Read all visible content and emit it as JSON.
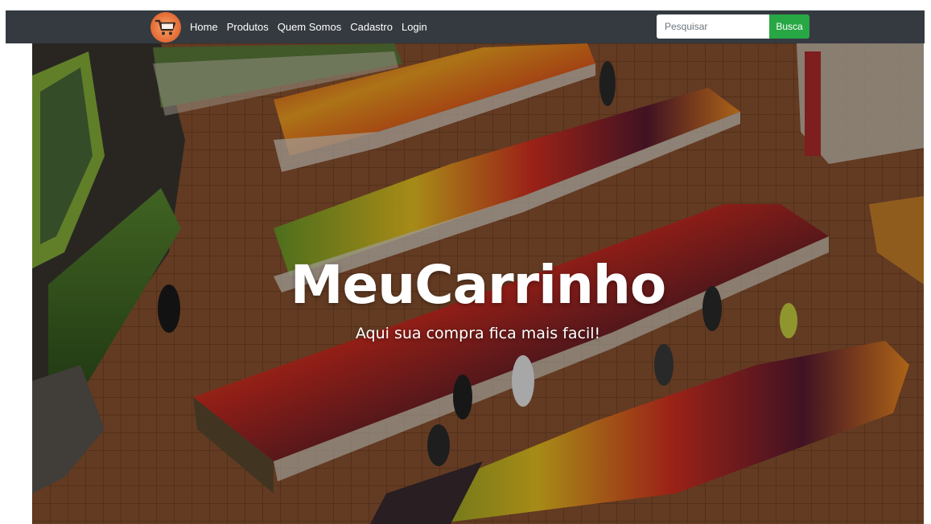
{
  "navbar": {
    "brand_icon": "shopping-cart-icon",
    "links": [
      "Home",
      "Produtos",
      "Quem Somos",
      "Cadastro",
      "Login"
    ],
    "search": {
      "placeholder": "Pesquisar",
      "value": "",
      "button_label": "Busca"
    }
  },
  "hero": {
    "title": "MeuCarrinho",
    "subtitle": "Aqui sua compra fica mais facil!"
  },
  "colors": {
    "navbar_bg": "#343a40",
    "search_button": "#28a745",
    "brand_orange": "#e8703a"
  }
}
